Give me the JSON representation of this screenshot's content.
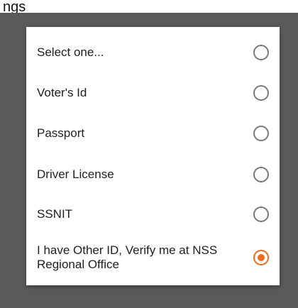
{
  "header": {
    "partial_title": "ngs"
  },
  "dialog": {
    "options": [
      {
        "label": "Select one...",
        "selected": false
      },
      {
        "label": "Voter's Id",
        "selected": false
      },
      {
        "label": "Passport",
        "selected": false
      },
      {
        "label": "Driver License",
        "selected": false
      },
      {
        "label": "SSNIT",
        "selected": false
      },
      {
        "label": "I have Other ID, Verify me at NSS Regional Office",
        "selected": true
      }
    ]
  },
  "colors": {
    "accent": "#f26a1b",
    "radio_unchecked": "#7a7a7a",
    "scrim": "#5a5a5a"
  }
}
